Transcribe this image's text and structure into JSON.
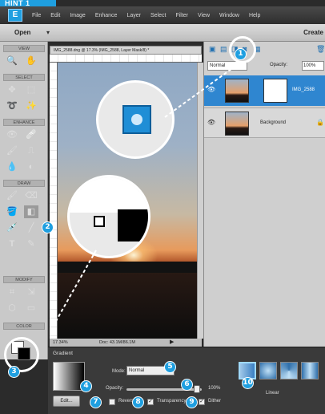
{
  "hint": "HINT 1",
  "app_logo": "E",
  "menu": [
    "File",
    "Edit",
    "Image",
    "Enhance",
    "Layer",
    "Select",
    "Filter",
    "View",
    "Window",
    "Help"
  ],
  "open_bar": {
    "open": "Open",
    "open_chevron": "▾",
    "create": "Create"
  },
  "toolbar": {
    "sections": [
      "VIEW",
      "SELECT",
      "ENHANCE",
      "DRAW",
      "MODIFY",
      "COLOR"
    ]
  },
  "document": {
    "tab_title": "IMG_2588.dng @ 17.3% (IMG_2588, Layer Mask/8) *",
    "zoom": "17.34%",
    "doc_size": "Doc: 43.1M/86.1M"
  },
  "layers": {
    "blend_mode": "Normal",
    "opacity_label": "Opacity:",
    "opacity_value": "100%",
    "items": [
      {
        "name": "IMG_2588"
      },
      {
        "name": "Background"
      }
    ]
  },
  "options": {
    "title": "Gradient",
    "edit_label": "Edit...",
    "mode_label": "Mode:",
    "mode_value": "Normal",
    "opacity_label": "Opacity:",
    "opacity_value": "100%",
    "opacity_level": 1.0,
    "reverse_label": "Reverse",
    "transparency_label": "Transparency",
    "dither_label": "Dither",
    "reverse_checked": false,
    "transparency_checked": true,
    "dither_checked": true,
    "type_label": "Linear",
    "types": [
      "linear",
      "radial",
      "angle",
      "reflected"
    ]
  },
  "callouts": [
    "1",
    "2",
    "3",
    "4",
    "5",
    "6",
    "7",
    "8",
    "9",
    "10"
  ],
  "colors": {
    "accent": "#1f9fe0",
    "selected_layer": "#2f86d0"
  }
}
